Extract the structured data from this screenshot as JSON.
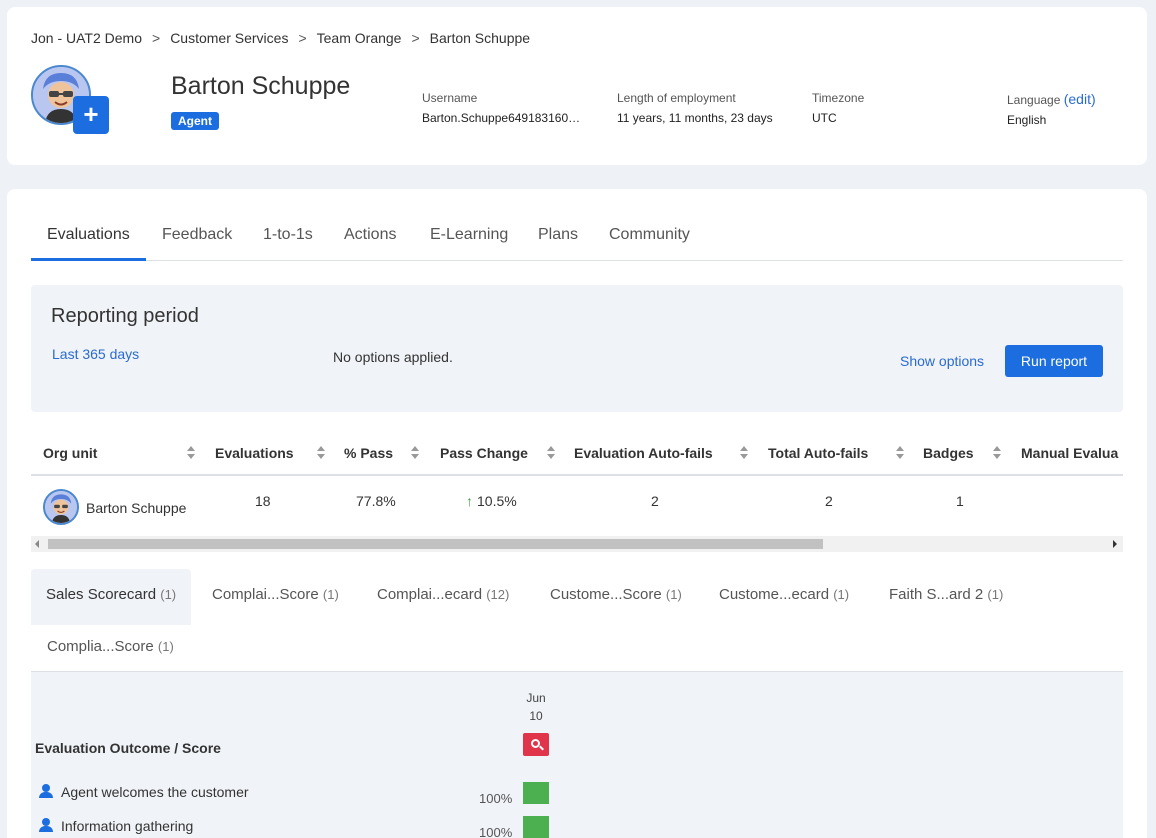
{
  "breadcrumb": [
    "Jon - UAT2 Demo",
    "Customer Services",
    "Team Orange",
    "Barton Schuppe"
  ],
  "profile": {
    "name": "Barton Schuppe",
    "role_badge": "Agent",
    "add_label": "+",
    "username_label": "Username",
    "username": "Barton.Schuppe649183160…",
    "employment_label": "Length of employment",
    "employment": "11 years, 11 months, 23 days",
    "timezone_label": "Timezone",
    "timezone": "UTC",
    "language_label": "Language",
    "language_edit": "(edit)",
    "language": "English"
  },
  "tabs": [
    "Evaluations",
    "Feedback",
    "1-to-1s",
    "Actions",
    "E-Learning",
    "Plans",
    "Community"
  ],
  "active_tab": "Evaluations",
  "report": {
    "title": "Reporting period",
    "period": "Last 365 days",
    "options_status": "No options applied.",
    "show_options": "Show options",
    "run_report": "Run report"
  },
  "table": {
    "headers": [
      "Org unit",
      "Evaluations",
      "% Pass",
      "Pass Change",
      "Evaluation Auto-fails",
      "Total Auto-fails",
      "Badges",
      "Manual Evalua"
    ],
    "row": {
      "org_unit": "Barton Schuppe",
      "evaluations": "18",
      "pass": "77.8%",
      "pass_change": "10.5%",
      "eval_autofails": "2",
      "total_autofails": "2",
      "badges": "1"
    }
  },
  "scorecard_tabs": [
    {
      "label": "Sales Scorecard",
      "count": "(1)"
    },
    {
      "label": "Complai...Score",
      "count": "(1)"
    },
    {
      "label": "Complai...ecard",
      "count": "(12)"
    },
    {
      "label": "Custome...Score",
      "count": "(1)"
    },
    {
      "label": "Custome...ecard",
      "count": "(1)"
    },
    {
      "label": "Faith S...ard 2",
      "count": "(1)"
    },
    {
      "label": "Complia...Score",
      "count": "(1)"
    }
  ],
  "grid": {
    "date_month": "Jun",
    "date_day": "10",
    "outcome_label": "Evaluation Outcome / Score",
    "questions": [
      {
        "label": "Agent welcomes the customer",
        "score": "100%",
        "score_fraction": 1.0
      },
      {
        "label": "Information gathering",
        "score": "100%",
        "score_fraction": 1.0
      }
    ]
  },
  "colors": {
    "accent": "#1b6de0",
    "fail": "#e0344a",
    "pass": "#4caf50",
    "link": "#2a6bd1"
  }
}
